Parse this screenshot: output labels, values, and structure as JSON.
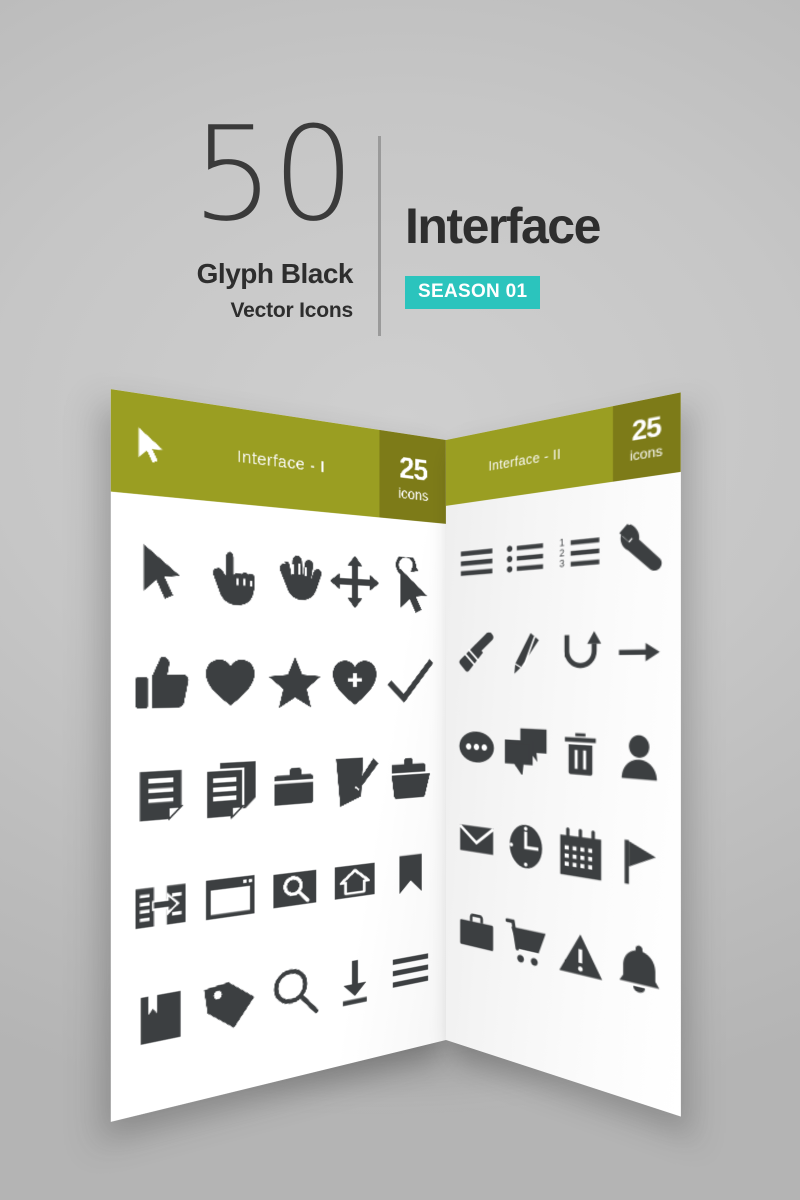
{
  "header": {
    "count": "50",
    "subtitle_1": "Glyph Black",
    "subtitle_2": "Vector Icons",
    "title": "Interface",
    "season_badge": "SEASON 01"
  },
  "colors": {
    "background": "#c4c4c4",
    "olive": "#9a9e22",
    "olive_dark": "#7d7b18",
    "teal": "#2bc4bd",
    "icon": "#3c3f41",
    "text_dark": "#2e2e2e"
  },
  "panels": [
    {
      "id": "panel-interface-1",
      "bar_title": "Interface - I",
      "count_number": "25",
      "count_label": "icons",
      "cursor_icon": "cursor-arrow-icon",
      "columns": 5,
      "icons": [
        "cursor-arrow-icon",
        "pointing-hand-icon",
        "grab-hand-icon",
        "move-arrows-icon",
        "click-cursor-icon",
        "thumbs-up-icon",
        "heart-icon",
        "star-icon",
        "heart-plus-icon",
        "checkmark-icon",
        "document-icon",
        "copy-documents-icon",
        "folder-icon",
        "edit-document-icon",
        "open-folder-icon",
        "file-transfer-icon",
        "browser-window-icon",
        "search-box-icon",
        "home-button-icon",
        "bookmark-icon",
        "bookmarked-book-icon",
        "tag-icon",
        "magnifier-icon",
        "download-icon",
        "menu-lines-icon"
      ]
    },
    {
      "id": "panel-interface-2",
      "bar_title": "Interface - II",
      "count_number": "25",
      "count_label": "icons",
      "columns": 4,
      "icons": [
        "list-lines-icon",
        "bullet-list-icon",
        "numbered-list-icon",
        "wrench-icon",
        "paintbrush-icon",
        "pencil-icon",
        "refresh-arrow-icon",
        "arrow-right-icon",
        "more-options-icon",
        "chat-bubbles-icon",
        "trash-icon",
        "user-icon",
        "envelope-icon",
        "clock-icon",
        "calendar-icon",
        "flag-icon",
        "briefcase-icon",
        "shopping-cart-icon",
        "warning-icon",
        "bell-icon"
      ]
    }
  ]
}
